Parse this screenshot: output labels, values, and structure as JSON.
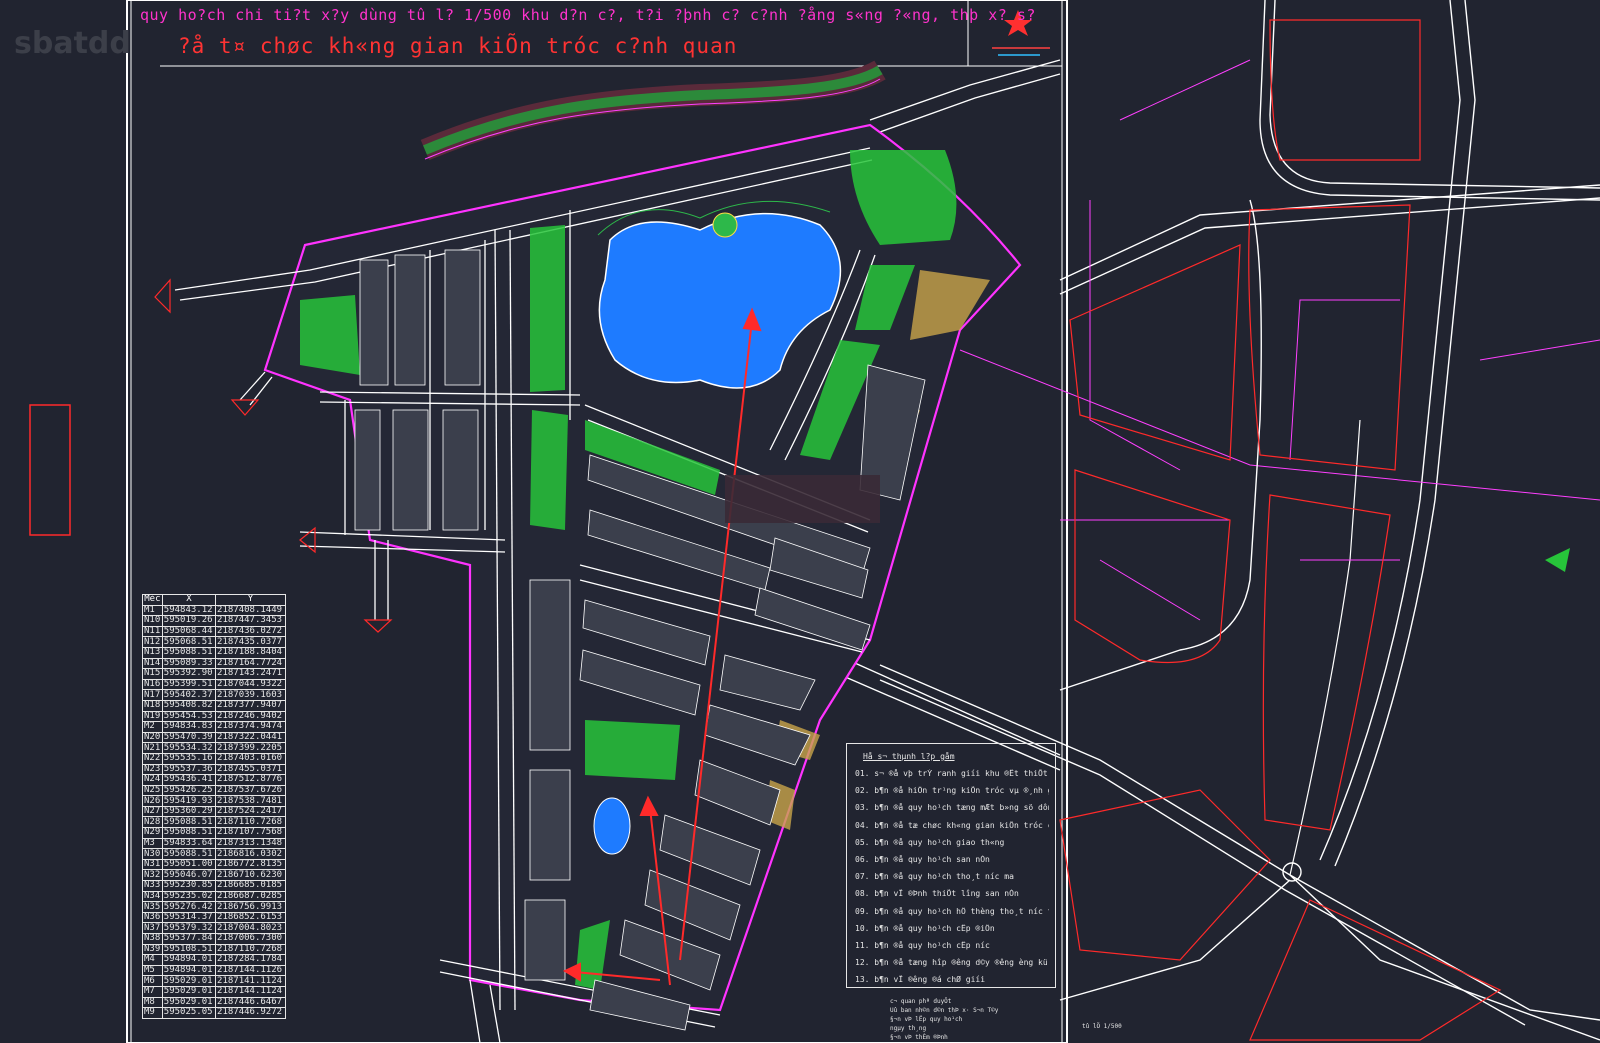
{
  "header": {
    "title_line1": "quy ho?ch chi ti?t x?y dùng tû l? 1/500 khu d?n c?, t?i ?þnh c? c?nh ?ång s«ng ?«ng, thþ x? s?",
    "title_line2": "?å t¤ chøc kh«ng gian kiÕn tróc c?nh quan",
    "watermark": "sbatdd"
  },
  "coordinate_table": {
    "headers": [
      "Mèc",
      "X",
      "Y"
    ],
    "rows": [
      [
        "M1",
        "594843.12",
        "2187408.1449"
      ],
      [
        "N10",
        "595019.26",
        "2187447.3453"
      ],
      [
        "N11",
        "595068.44",
        "2187436.0272"
      ],
      [
        "N12",
        "595068.51",
        "2187435.0377"
      ],
      [
        "N13",
        "595088.51",
        "2187188.8404"
      ],
      [
        "N14",
        "595089.33",
        "2187164.7724"
      ],
      [
        "N15",
        "595392.90",
        "2187143.2471"
      ],
      [
        "N16",
        "595399.51",
        "2187044.9322"
      ],
      [
        "N17",
        "595402.37",
        "2187039.1603"
      ],
      [
        "N18",
        "595408.82",
        "2187377.9407"
      ],
      [
        "N19",
        "595454.53",
        "2187246.9402"
      ],
      [
        "M2",
        "594834.83",
        "2187374.9474"
      ],
      [
        "N20",
        "595470.39",
        "2187322.0441"
      ],
      [
        "N21",
        "595534.32",
        "2187399.2205"
      ],
      [
        "N22",
        "595535.16",
        "2187403.0160"
      ],
      [
        "N23",
        "595537.36",
        "2187455.0371"
      ],
      [
        "N24",
        "595436.41",
        "2187512.8776"
      ],
      [
        "N25",
        "595426.25",
        "2187537.6726"
      ],
      [
        "N26",
        "595419.93",
        "2187538.7481"
      ],
      [
        "N27",
        "595360.29",
        "2187524.2417"
      ],
      [
        "N28",
        "595088.51",
        "2187110.7268"
      ],
      [
        "N29",
        "595088.51",
        "2187107.7568"
      ],
      [
        "M3",
        "594833.64",
        "2187313.1348"
      ],
      [
        "N30",
        "595088.51",
        "2186816.0302"
      ],
      [
        "N31",
        "595051.00",
        "2186772.8135"
      ],
      [
        "N32",
        "595046.07",
        "2186710.6230"
      ],
      [
        "N33",
        "595230.85",
        "2186685.0185"
      ],
      [
        "N34",
        "595235.02",
        "2186687.0285"
      ],
      [
        "N35",
        "595276.42",
        "2186756.9913"
      ],
      [
        "N36",
        "595314.37",
        "2186852.6153"
      ],
      [
        "N37",
        "595379.32",
        "2187004.8023"
      ],
      [
        "N38",
        "595377.84",
        "2187006.7300"
      ],
      [
        "N39",
        "595108.51",
        "2187110.7268"
      ],
      [
        "M4",
        "594894.01",
        "2187284.1784"
      ],
      [
        "M5",
        "594894.01",
        "2187144.1126"
      ],
      [
        "M6",
        "595029.01",
        "2187141.1124"
      ],
      [
        "M7",
        "595029.01",
        "2187144.1124"
      ],
      [
        "M8",
        "595029.01",
        "2187446.6467"
      ],
      [
        "M9",
        "595025.05",
        "2187446.9272"
      ]
    ]
  },
  "legend": {
    "title": "Hå s¬ thµnh l?p gåm",
    "items": [
      "01. s¬ ®å vþ trÝ ranh giíi khu ®Êt thiÕt kÕ",
      "02. b¶n ®å hiÖn tr¹ng kiÕn tróc vµ ®¸nh gi¸ ®Êt x©y",
      "03. b¶n ®å quy ho¹ch tæng mÆt b»ng sö dông ®Êt",
      "04. b¶n ®å tæ chøc kh«ng gian kiÕn tróc c¶nh quan",
      "05. b¶n ®å quy ho¹ch giao th«ng",
      "06. b¶n ®å quy ho¹ch san nÒn",
      "07. b¶n ®å quy ho¹ch tho¸t n­íc m­a",
      "08. b¶n vÏ ®Þnh thiÕt l­îng san nÒn",
      "09. b¶n ®å quy ho¹ch hÖ thèng tho¸t n­íc th¶i vµ vsmt",
      "10. b¶n ®å quy ho¹ch cÊp ®iÖn",
      "11. b¶n ®å quy ho¹ch cÊp n­íc",
      "12. b¶n ®å tæng hîp ®­êng d©y ®­êng èng kü thuËt",
      "13. b¶n vÏ ®­êng ®á chØ giíi"
    ]
  },
  "stamp": {
    "lines": [
      "c¬ quan phª duyÖt",
      "Uû ban nh©n d©n thÞ x· S¬n T©y",
      "§¬n vÞ lËp quy ho¹ch",
      "ngµy",
      "th¸ng",
      "§¬n vÞ thÈm ®Þnh"
    ],
    "right_label": "tû lÖ 1/500"
  },
  "colors": {
    "background": "#212430",
    "road_edge": "#ffffff",
    "boundary": "#ff33ff",
    "redline": "#ff2a2a",
    "lake": "#1e7bff",
    "green": "#27c43a"
  }
}
